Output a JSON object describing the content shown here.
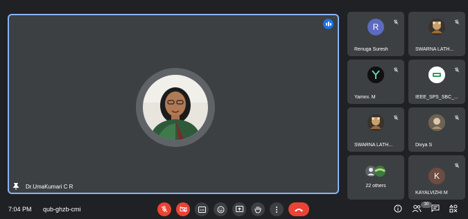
{
  "main": {
    "speaker_name": "Dr.UmaKumari C R"
  },
  "participants": [
    {
      "name": "Renuga Suresh",
      "initial": "R",
      "avatar_color": "#5c6bc0"
    },
    {
      "name": "SWARNA LATH...",
      "initial": "",
      "avatar_color": "#b5894f"
    },
    {
      "name": "Yamini. M",
      "initial": "",
      "avatar_color": "#111111"
    },
    {
      "name": "IEEE_SPS_SBC_...",
      "initial": "",
      "avatar_color": "#ffffff"
    },
    {
      "name": "SWARNA LATH...",
      "initial": "",
      "avatar_color": "#b5894f"
    },
    {
      "name": "Divya S",
      "initial": "",
      "avatar_color": "#8a7a66"
    },
    {
      "name": "22 others",
      "initial": "",
      "avatar_color": "#5f6368"
    },
    {
      "name": "KAYALVIZHI M",
      "initial": "K",
      "avatar_color": "#6d4c41"
    }
  ],
  "bottom": {
    "time": "7:04 PM",
    "meeting_code": "qub-ghzb-cmi",
    "participant_count": "30"
  },
  "colors": {
    "background": "#202124",
    "tile": "#3c4043",
    "accent": "#8ab4f8",
    "danger": "#ea4335"
  },
  "icons": {
    "controls": [
      "mic-off-icon",
      "camera-off-icon",
      "captions-icon",
      "emoji-icon",
      "present-icon",
      "raise-hand-icon",
      "more-options-icon",
      "end-call-icon"
    ],
    "right": [
      "info-icon",
      "people-icon",
      "chat-icon",
      "activities-icon"
    ]
  }
}
